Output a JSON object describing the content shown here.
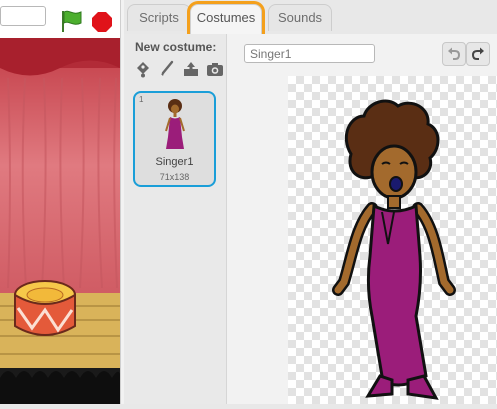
{
  "stage": {
    "green_flag": "green-flag-icon",
    "stop": "stop-icon"
  },
  "tabs": [
    {
      "label": "Scripts"
    },
    {
      "label": "Costumes",
      "active": true
    },
    {
      "label": "Sounds"
    }
  ],
  "costume_panel": {
    "new_costume_label": "New costume:",
    "icons": [
      "paint-new-icon",
      "paint-brush-icon",
      "upload-icon",
      "camera-icon"
    ],
    "costumes": [
      {
        "number": "1",
        "name": "Singer1",
        "size": "71x138",
        "selected": true
      }
    ]
  },
  "editor": {
    "costume_name": "Singer1"
  },
  "colors": {
    "accent": "#1a9ed8",
    "active_tab_ring": "#f4a01c",
    "dress": "#9b1d7a",
    "skin": "#a36a2d"
  }
}
